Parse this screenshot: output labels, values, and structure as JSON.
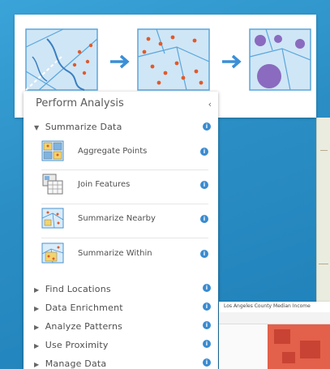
{
  "panel": {
    "title": "Perform Analysis",
    "collapse_glyph": "‹",
    "info_glyph": "i"
  },
  "sections": [
    {
      "label": "Summarize Data",
      "expanded": true
    },
    {
      "label": "Find Locations",
      "expanded": false
    },
    {
      "label": "Data Enrichment",
      "expanded": false
    },
    {
      "label": "Analyze Patterns",
      "expanded": false
    },
    {
      "label": "Use Proximity",
      "expanded": false
    },
    {
      "label": "Manage Data",
      "expanded": false
    }
  ],
  "tools": [
    {
      "label": "Aggregate Points",
      "icon": "aggregate-points-icon"
    },
    {
      "label": "Join Features",
      "icon": "join-features-icon"
    },
    {
      "label": "Summarize Nearby",
      "icon": "summarize-nearby-icon"
    },
    {
      "label": "Summarize Within",
      "icon": "summarize-within-icon"
    }
  ],
  "glyphs": {
    "expanded": "▼",
    "collapsed": "▶"
  },
  "thumbnail": {
    "title": "Los Angeles County Median Income"
  },
  "colors": {
    "background": "#2d93c8",
    "accent_blue": "#3a8bd0",
    "point_red": "#e05a2a",
    "polygon_fill": "#cfe6f6",
    "circle_purple": "#8a6bbf"
  }
}
